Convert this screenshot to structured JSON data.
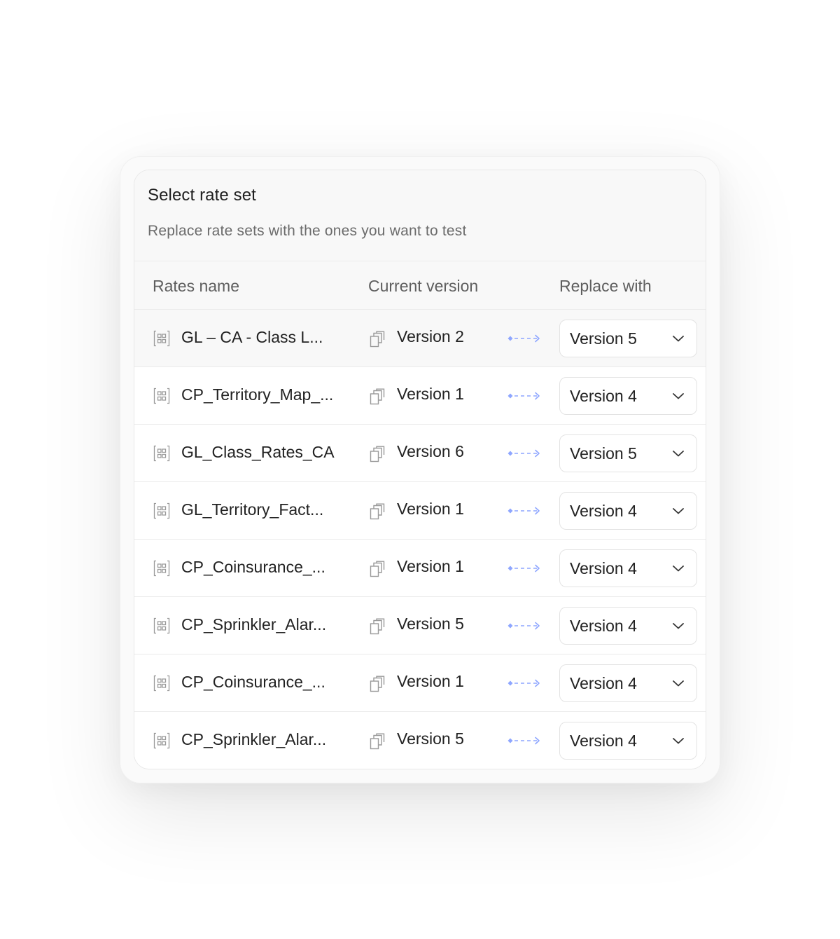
{
  "card": {
    "title": "Select rate set",
    "subtitle": "Replace rate sets with the ones you want to test"
  },
  "table": {
    "headers": {
      "name": "Rates name",
      "current": "Current version",
      "replace": "Replace with"
    },
    "rows": [
      {
        "name": "GL – CA - Class L...",
        "current": "Version 2",
        "replace": "Version 5"
      },
      {
        "name": "CP_Territory_Map_...",
        "current": "Version 1",
        "replace": "Version 4"
      },
      {
        "name": "GL_Class_Rates_CA",
        "current": "Version 6",
        "replace": "Version 5"
      },
      {
        "name": "GL_Territory_Fact...",
        "current": "Version 1",
        "replace": "Version 4"
      },
      {
        "name": "CP_Coinsurance_...",
        "current": "Version 1",
        "replace": "Version 4"
      },
      {
        "name": "CP_Sprinkler_Alar...",
        "current": "Version 5",
        "replace": "Version 4"
      },
      {
        "name": "CP_Coinsurance_...",
        "current": "Version 1",
        "replace": "Version 4"
      },
      {
        "name": "CP_Sprinkler_Alar...",
        "current": "Version 5",
        "replace": "Version 4"
      }
    ]
  },
  "icons": {
    "rate": "table-grid-icon",
    "version": "copy-versions-icon",
    "arrow": "dashed-arrow-right-icon",
    "dropdown": "chevron-down-icon"
  },
  "colors": {
    "accent_arrow": "#8ea6ff",
    "icon_gray": "#9a9a9a",
    "header_bg": "#f8f8f8",
    "border": "#ebebeb"
  }
}
